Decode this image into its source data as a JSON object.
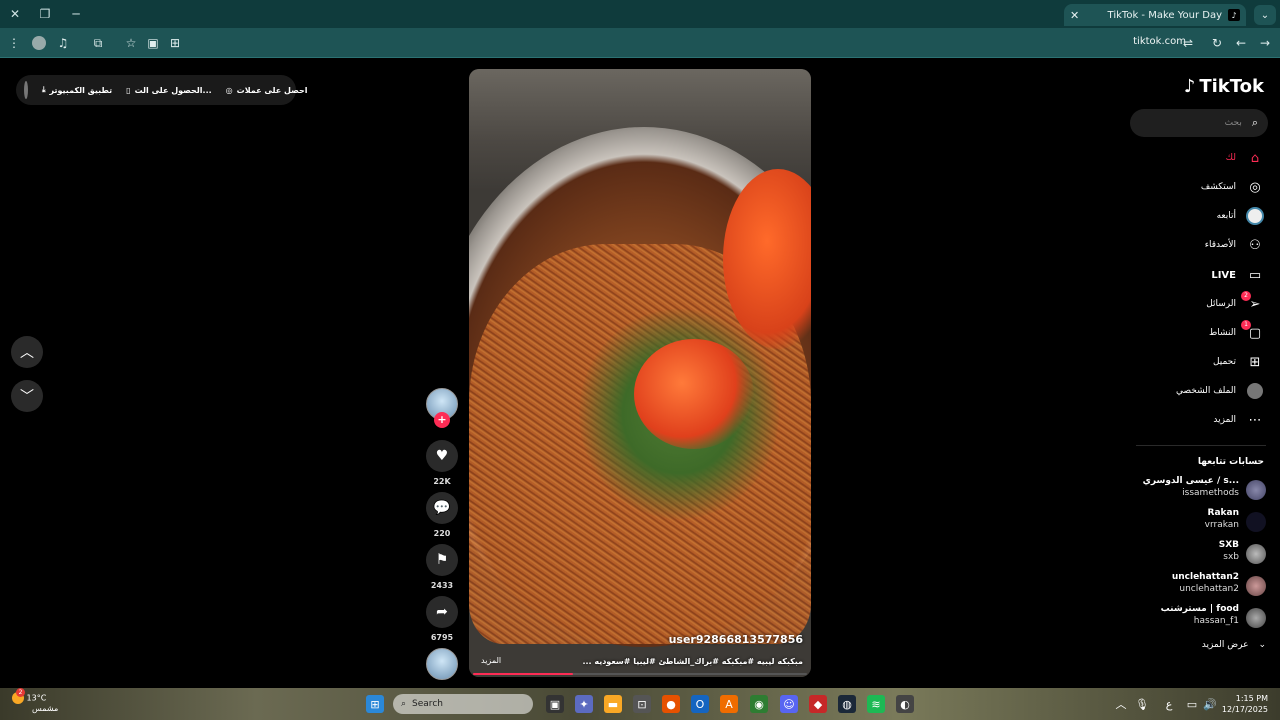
{
  "browser": {
    "tab_title": "TikTok - Make Your Day",
    "url": "tiktok.com",
    "controls": {
      "close": "✕",
      "restore": "❐",
      "minimize": "─",
      "new_tab": "+"
    }
  },
  "topbar": {
    "coins_label": "احصل على عملات",
    "get_app_label": "الحصول على الت...",
    "desktop_app_label": "تطبيق الكمبيوتر"
  },
  "video": {
    "username": "user92866813577856",
    "caption": "مبكبكه ليبيه #مبكبكه #براك_الشاطئ #ليبيا #سعوديه ...",
    "more_label": "المزيد",
    "progress": 0.3
  },
  "actions": {
    "likes": "22K",
    "comments": "220",
    "saves": "2433",
    "shares": "6795"
  },
  "sidebar": {
    "logo": "TikTok",
    "search_placeholder": "بحث",
    "items": [
      {
        "label": "لك",
        "icon": "home-icon"
      },
      {
        "label": "استكشف",
        "icon": "compass-icon"
      },
      {
        "label": "أتابعه",
        "icon": "following-icon"
      },
      {
        "label": "الأصدقاء",
        "icon": "friends-icon"
      },
      {
        "label": "LIVE",
        "icon": "live-icon"
      },
      {
        "label": "الرسائل",
        "icon": "messages-icon",
        "badge": "2"
      },
      {
        "label": "النشاط",
        "icon": "activity-icon",
        "badge": "1"
      },
      {
        "label": "تحميل",
        "icon": "upload-icon"
      },
      {
        "label": "الملف الشخصي",
        "icon": "profile-icon"
      },
      {
        "label": "المزيد",
        "icon": "more-icon"
      }
    ],
    "following_title": "حسابات تتابعها",
    "accounts": [
      {
        "name": "عيسى الدوسري / s...",
        "handle": "issamethods"
      },
      {
        "name": "Rakan",
        "handle": "vrrakan"
      },
      {
        "name": "SXB",
        "handle": "sxb"
      },
      {
        "name": "unclehattan2",
        "handle": "unclehattan2"
      },
      {
        "name": "مسترشنب | food",
        "handle": "hassan_f1"
      }
    ],
    "see_more": "عرض المزيد"
  },
  "taskbar": {
    "temperature": "13°C",
    "weather": "مشمس",
    "weather_badge": "2",
    "search_label": "Search",
    "time": "1:15 PM",
    "date": "12/17/2025"
  },
  "colors": {
    "accent": "#fe2c55",
    "chrome": "#1e5455",
    "titlebar": "#0f3b3c"
  }
}
